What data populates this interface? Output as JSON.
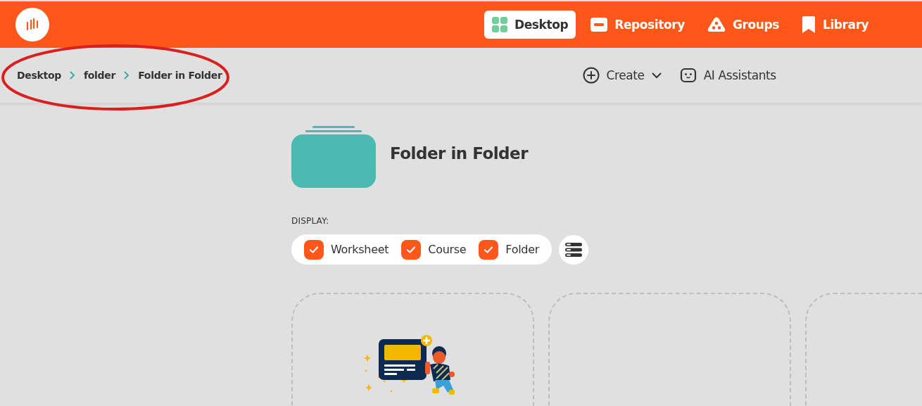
{
  "header": {
    "nav": [
      {
        "label": "Desktop",
        "selected": true
      },
      {
        "label": "Repository",
        "selected": false
      },
      {
        "label": "Groups",
        "selected": false
      },
      {
        "label": "Library",
        "selected": false
      }
    ]
  },
  "breadcrumb": [
    "Desktop",
    "folder",
    "Folder in Folder"
  ],
  "toolbar": [
    {
      "label": "Create",
      "kind": "dropdown"
    },
    {
      "label": "AI Assistants",
      "kind": "button"
    }
  ],
  "folder": {
    "title": "Folder in Folder"
  },
  "display": {
    "label": "DISPLAY:",
    "filters": [
      {
        "label": "Worksheet",
        "checked": true
      },
      {
        "label": "Course",
        "checked": true
      },
      {
        "label": "Folder",
        "checked": true
      }
    ]
  },
  "cards": [
    {
      "kind": "illustration"
    },
    {
      "kind": "empty"
    },
    {
      "kind": "empty"
    }
  ]
}
